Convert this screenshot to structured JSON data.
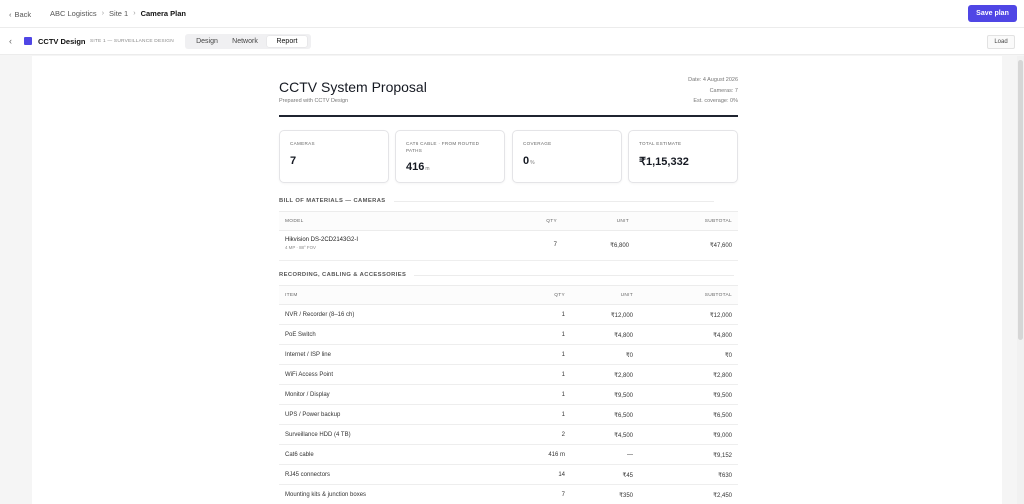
{
  "header": {
    "back_label": "Back",
    "breadcrumbs": [
      "ABC Logistics",
      "Site 1",
      "Camera Plan"
    ],
    "save_label": "Save plan"
  },
  "subheader": {
    "app_name": "CCTV Design",
    "app_sub": "SITE 1 — SURVEILLANCE DESIGN",
    "tabs": [
      "Design",
      "Network",
      "Report"
    ],
    "active_tab": "Report",
    "load_label": "Load"
  },
  "colors": {
    "accent": "#4f46e5"
  },
  "report": {
    "title": "CCTV System Proposal",
    "subtitle": "Prepared with CCTV Design",
    "meta": {
      "date": "Date: 4 August 2026",
      "cameras": "Cameras: 7",
      "coverage": "Est. coverage: 0%"
    },
    "cards": [
      {
        "label": "CAMERAS",
        "value": "7",
        "unit": ""
      },
      {
        "label": "CAT6 CABLE · FROM ROUTED PATHS",
        "value": "416",
        "unit": "m"
      },
      {
        "label": "COVERAGE",
        "value": "0",
        "unit": "%"
      },
      {
        "label": "TOTAL ESTIMATE",
        "value": "₹1,15,332",
        "unit": ""
      }
    ],
    "bom_cameras": {
      "title": "BILL OF MATERIALS — CAMERAS",
      "columns": [
        "MODEL",
        "QTY",
        "UNIT",
        "SUBTOTAL"
      ],
      "rows": [
        {
          "model": "Hikvision DS-2CD2143G2-I",
          "spec": "4 MP · 88° FOV",
          "qty": "7",
          "unit": "₹6,800",
          "subtotal": "₹47,600"
        }
      ]
    },
    "accessories": {
      "title": "RECORDING, CABLING & ACCESSORIES",
      "columns": [
        "ITEM",
        "QTY",
        "UNIT",
        "SUBTOTAL"
      ],
      "rows": [
        {
          "item": "NVR / Recorder (8–16 ch)",
          "qty": "1",
          "unit": "₹12,000",
          "subtotal": "₹12,000"
        },
        {
          "item": "PoE Switch",
          "qty": "1",
          "unit": "₹4,800",
          "subtotal": "₹4,800"
        },
        {
          "item": "Internet / ISP line",
          "qty": "1",
          "unit": "₹0",
          "subtotal": "₹0"
        },
        {
          "item": "WiFi Access Point",
          "qty": "1",
          "unit": "₹2,800",
          "subtotal": "₹2,800"
        },
        {
          "item": "Monitor / Display",
          "qty": "1",
          "unit": "₹9,500",
          "subtotal": "₹9,500"
        },
        {
          "item": "UPS / Power backup",
          "qty": "1",
          "unit": "₹6,500",
          "subtotal": "₹6,500"
        },
        {
          "item": "Surveillance HDD (4 TB)",
          "qty": "2",
          "unit": "₹4,500",
          "subtotal": "₹9,000"
        },
        {
          "item": "Cat6 cable",
          "qty": "416 m",
          "unit": "—",
          "subtotal": "₹9,152"
        },
        {
          "item": "RJ45 connectors",
          "qty": "14",
          "unit": "₹45",
          "subtotal": "₹630"
        },
        {
          "item": "Mounting kits & junction boxes",
          "qty": "7",
          "unit": "₹350",
          "subtotal": "₹2,450"
        }
      ]
    }
  }
}
